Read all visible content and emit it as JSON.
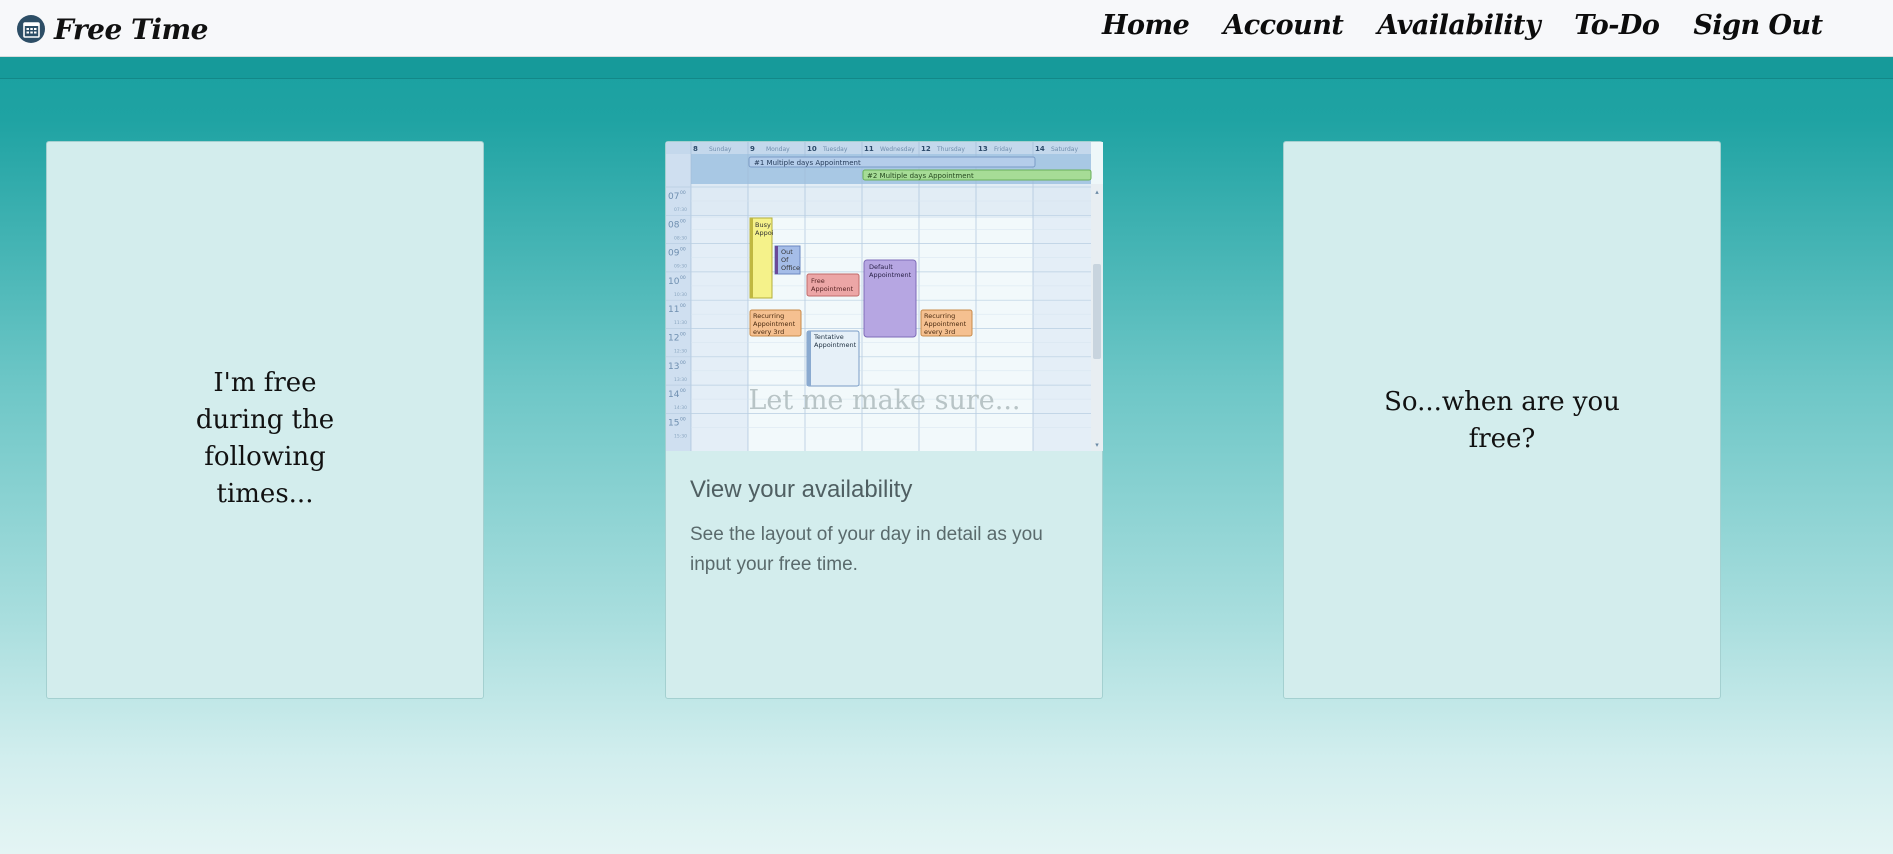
{
  "brand": {
    "name": "Free Time",
    "icon": "calendar-icon"
  },
  "nav": {
    "items": [
      "Home",
      "Account",
      "Availability",
      "To-Do",
      "Sign Out"
    ]
  },
  "cards": {
    "left": {
      "text": "I'm free during the following times..."
    },
    "middle": {
      "image_overlay": "Let me make sure...",
      "title": "View your availability",
      "description": "See the layout of your day in detail as you input your free time."
    },
    "right": {
      "text": "So...when are you free?"
    }
  },
  "calendar": {
    "dates": [
      "8",
      "9",
      "10",
      "11",
      "12",
      "13",
      "14"
    ],
    "days": [
      "Sunday",
      "Monday",
      "Tuesday",
      "Wednesday",
      "Thursday",
      "Friday",
      "Saturday"
    ],
    "allday": [
      "#1 Multiple days Appointment",
      "#2 Multiple days Appointment"
    ],
    "hours": [
      "07",
      "08",
      "09",
      "10",
      "11",
      "12",
      "13",
      "14",
      "15"
    ],
    "minute_label": "00",
    "half_labels": [
      "07:30",
      "08:30",
      "09:30",
      "10:30",
      "11:30",
      "12:30",
      "13:30",
      "14:30",
      "15:30"
    ],
    "appointments": {
      "busy": [
        "Busy",
        "Appoi"
      ],
      "out_of_office": [
        "Out",
        "Of",
        "Office"
      ],
      "free": [
        "Free",
        "Appointment"
      ],
      "default": [
        "Default",
        "Appointment"
      ],
      "recurring": [
        "Recurring",
        "Appointment",
        "every 3rd"
      ],
      "tentative": [
        "Tentative",
        "Appointment"
      ]
    }
  }
}
